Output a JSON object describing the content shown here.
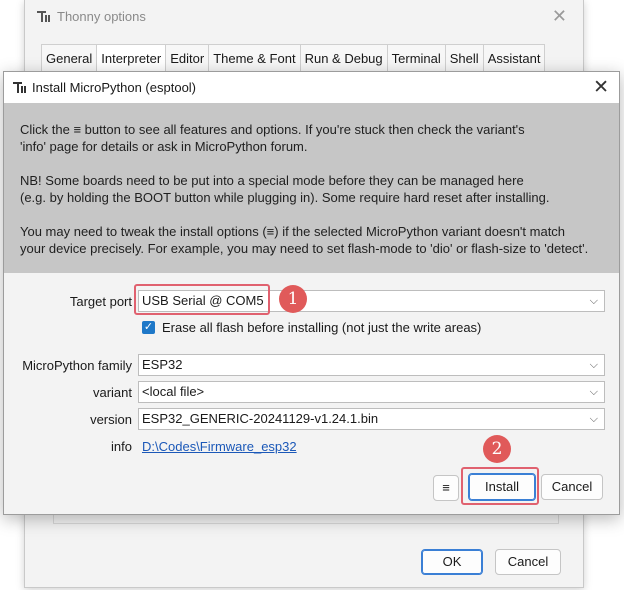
{
  "options_window": {
    "title": "Thonny options",
    "close_glyph": "✕",
    "tabs": [
      {
        "label": "General"
      },
      {
        "label": "Interpreter"
      },
      {
        "label": "Editor"
      },
      {
        "label": "Theme & Font"
      },
      {
        "label": "Run & Debug"
      },
      {
        "label": "Terminal"
      },
      {
        "label": "Shell"
      },
      {
        "label": "Assistant"
      }
    ],
    "active_tab": "Interpreter",
    "ok_label": "OK",
    "cancel_label": "Cancel"
  },
  "dialog": {
    "title": "Install MicroPython (esptool)",
    "close_glyph": "✕",
    "info_lines": [
      "Click the ≡ button to see all features and options. If you're stuck then check the variant's",
      "'info' page for details or ask in MicroPython forum.",
      "",
      "NB! Some boards need to be put into a special mode before they can be managed here",
      "(e.g. by holding the BOOT button while plugging in). Some require hard reset after installing.",
      "",
      "You may need to tweak the install options (≡) if the selected MicroPython variant doesn't match",
      "your device precisely. For example, you may need to set flash-mode to 'dio' or flash-size to 'detect'."
    ],
    "target_port": {
      "label": "Target port",
      "value": "USB Serial @ COM5"
    },
    "erase_flash": {
      "label": "Erase all flash before installing (not just the write areas)",
      "checked": true,
      "check_glyph": "✓"
    },
    "family": {
      "label": "MicroPython family",
      "value": "ESP32"
    },
    "variant": {
      "label": "variant",
      "value": "<local file>"
    },
    "version": {
      "label": "version",
      "value": "ESP32_GENERIC-20241129-v1.24.1.bin"
    },
    "info": {
      "label": "info",
      "value": "D:\\Codes\\Firmware_esp32"
    },
    "menu_button_label": "≡",
    "install_label": "Install",
    "cancel_label": "Cancel",
    "chevron_glyph": "⌵"
  },
  "annotations": {
    "badge_1": "1",
    "badge_2": "2",
    "highlight_color": "#e0616f",
    "badge_color": "#e05a5a"
  },
  "colors": {
    "accent": "#3a7fd5",
    "link": "#1b58b8",
    "checkbox": "#1e78c8"
  }
}
